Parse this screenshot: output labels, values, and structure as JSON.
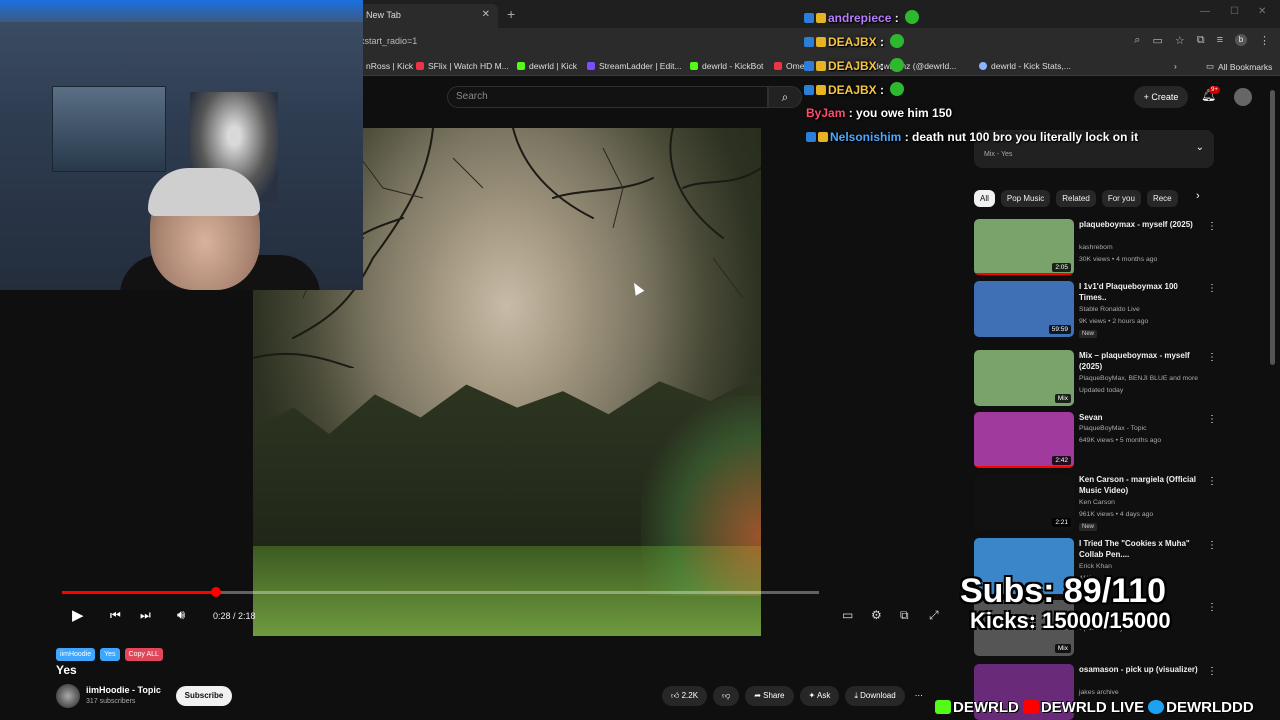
{
  "browser": {
    "tab_title": "New Tab",
    "url_fragment": "xstart_radio=1",
    "bookmarks": [
      "nRoss | Kick",
      "SFlix | Watch HD M...",
      "dewrld | Kick",
      "StreamLadder | Edit...",
      "dewrld - KickBot",
      "Ome",
      "dewrld nz (@dewrld...",
      "dewrld - Kick Stats,..."
    ],
    "all_bookmarks": "All Bookmarks"
  },
  "yt_header": {
    "search_placeholder": "Search",
    "create_label": "Create",
    "notif_count": "9+"
  },
  "player": {
    "timecode": "0:28 / 2:18",
    "progress_fraction": 0.203
  },
  "video": {
    "tags": [
      {
        "label": "iimHoodie",
        "color": "#3ea6ff"
      },
      {
        "label": "Yes",
        "color": "#3ea6ff"
      },
      {
        "label": "Copy ALL",
        "color": "#e0475b"
      }
    ],
    "title": "Yes",
    "channel": "iimHoodie - Topic",
    "subscribers": "317 subscribers",
    "subscribe_label": "Subscribe",
    "likes": "2.2K",
    "share_label": "Share",
    "ask_label": "Ask",
    "download_label": "Download"
  },
  "chat": [
    {
      "user": "andrepiece",
      "color": "#b77cff",
      "message": "",
      "emote": true
    },
    {
      "user": "DEAJBX",
      "color": "#f5c542",
      "message": "",
      "emote": true
    },
    {
      "user": "DEAJBX",
      "color": "#f5c542",
      "message": "",
      "emote": true
    },
    {
      "user": "DEAJBX",
      "color": "#f5c542",
      "message": "",
      "emote": true
    },
    {
      "user": "ByJam",
      "color": "#ff4d6d",
      "message": "you owe him 150",
      "emote": false
    },
    {
      "user": "Nelsonishim",
      "color": "#4da6ff",
      "message": "death nut 100 bro you literally lock on it",
      "emote": false
    }
  ],
  "mix_panel": {
    "subtitle": "Mix - Yes"
  },
  "chips": [
    "All",
    "Pop Music",
    "Related",
    "For you",
    "Rece"
  ],
  "related": [
    {
      "title": "plaqueboymax - myself (2025)",
      "channel": "kashrebom",
      "meta": "30K views • 4 months ago",
      "duration": "2:05",
      "new": false,
      "thumb": "#7aa36b"
    },
    {
      "title": "I 1v1'd Plaqueboymax 100 Times..",
      "channel": "Stable Ronaldo Live",
      "meta": "9K views • 2 hours ago",
      "duration": "59:59",
      "new": true,
      "thumb": "#3f6fb5"
    },
    {
      "title": "Mix – plaqueboymax - myself (2025)",
      "channel": "PlaqueBoyMax, BENJI BLUE and more",
      "meta": "Updated today",
      "duration": "Mix",
      "new": false,
      "thumb": "#7aa36b"
    },
    {
      "title": "Sevan",
      "channel": "PlaqueBoyMax - Topic",
      "meta": "649K views • 5 months ago",
      "duration": "2:42",
      "new": false,
      "thumb": "#a03a9c"
    },
    {
      "title": "Ken Carson - margiela (Official Music Video)",
      "channel": "Ken Carson",
      "meta": "961K views • 4 days ago",
      "duration": "2:21",
      "new": true,
      "thumb": "#111111"
    },
    {
      "title": "I Tried The \"Cookies x Muha\" Collab Pen....",
      "channel": "Erick Khan",
      "meta": "41K",
      "duration": "",
      "new": false,
      "thumb": "#3b86c9"
    },
    {
      "title": "",
      "channel": "",
      "meta": "Updated today",
      "duration": "Mix",
      "new": false,
      "thumb": "#555555"
    },
    {
      "title": "osamason - pick up (visualizer)",
      "channel": "jakes archive",
      "meta": "",
      "duration": "",
      "new": false,
      "thumb": "#6a2a7a"
    }
  ],
  "overlay": {
    "subs": "Subs: 89/110",
    "kicks": "Kicks: 15000/15000",
    "social": [
      "DEWRLD",
      "DEWRLD LIVE",
      "DEWRLDDD"
    ]
  }
}
